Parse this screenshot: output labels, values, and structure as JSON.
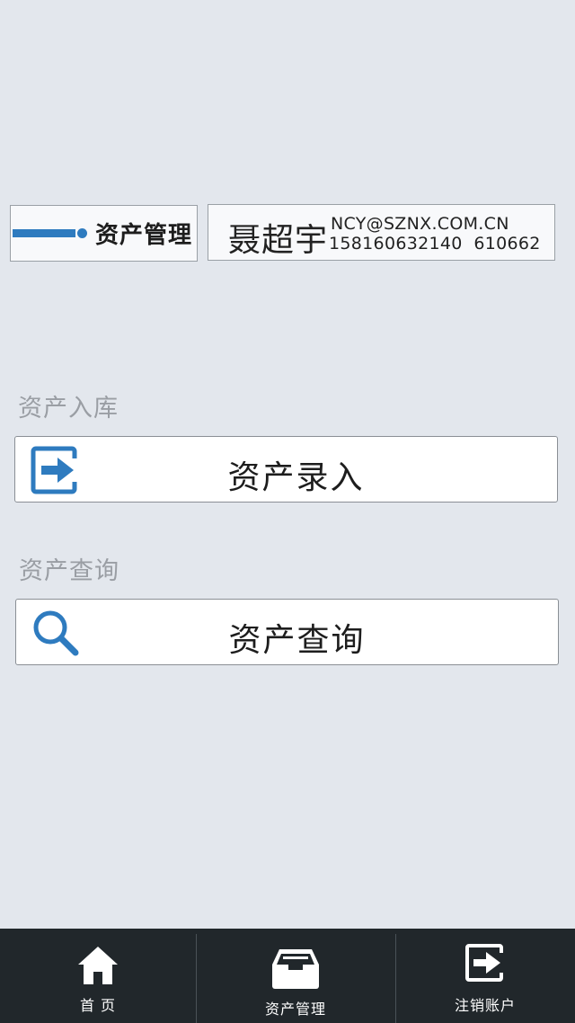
{
  "header": {
    "module_title": "资产管理",
    "user": {
      "name": "聂超宇",
      "email": "NCY@SZNX.COM.CN",
      "phone": "15816063214Ō  610662"
    }
  },
  "sections": [
    {
      "label": "资产入库",
      "button_label": "资产录入",
      "icon": "sign-in-arrow-icon"
    },
    {
      "label": "资产查询",
      "button_label": "资产查询",
      "icon": "search-icon"
    }
  ],
  "tabbar": {
    "tabs": [
      {
        "label": "首 页",
        "icon": "home-icon"
      },
      {
        "label": "资产管理",
        "icon": "inbox-tray-icon"
      },
      {
        "label": "注销账户",
        "icon": "logout-icon"
      }
    ]
  },
  "colors": {
    "background": "#e3e7ed",
    "accent": "#2e7bbf",
    "tabbar": "#21272b"
  }
}
